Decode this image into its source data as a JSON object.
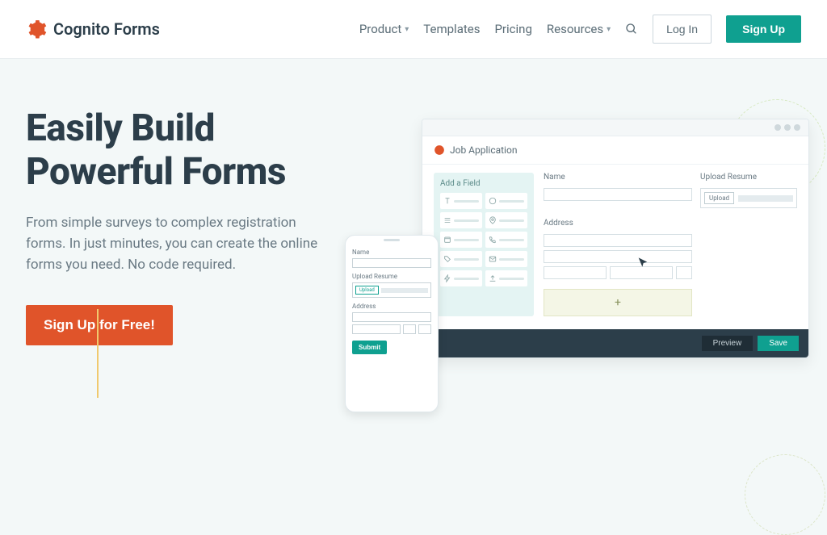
{
  "brand": "Cognito Forms",
  "nav": {
    "product": "Product",
    "templates": "Templates",
    "pricing": "Pricing",
    "resources": "Resources",
    "login": "Log In",
    "signup": "Sign Up"
  },
  "hero": {
    "headline_line1": "Easily Build",
    "headline_line2": "Powerful Forms",
    "sub": "From simple surveys to complex registration forms. In just minutes, you can create the online forms you need. No code required.",
    "cta": "Sign Up for Free!"
  },
  "builder": {
    "title": "Job Application",
    "palette_title": "Add a Field",
    "name_label": "Name",
    "upload_label": "Upload Resume",
    "upload_btn": "Upload",
    "address_label": "Address",
    "add_icon": "+",
    "preview_btn": "Preview",
    "save_btn": "Save"
  },
  "phone": {
    "name_label": "Name",
    "upload_label": "Upload Resume",
    "upload_btn": "Upload",
    "address_label": "Address",
    "submit": "Submit"
  }
}
